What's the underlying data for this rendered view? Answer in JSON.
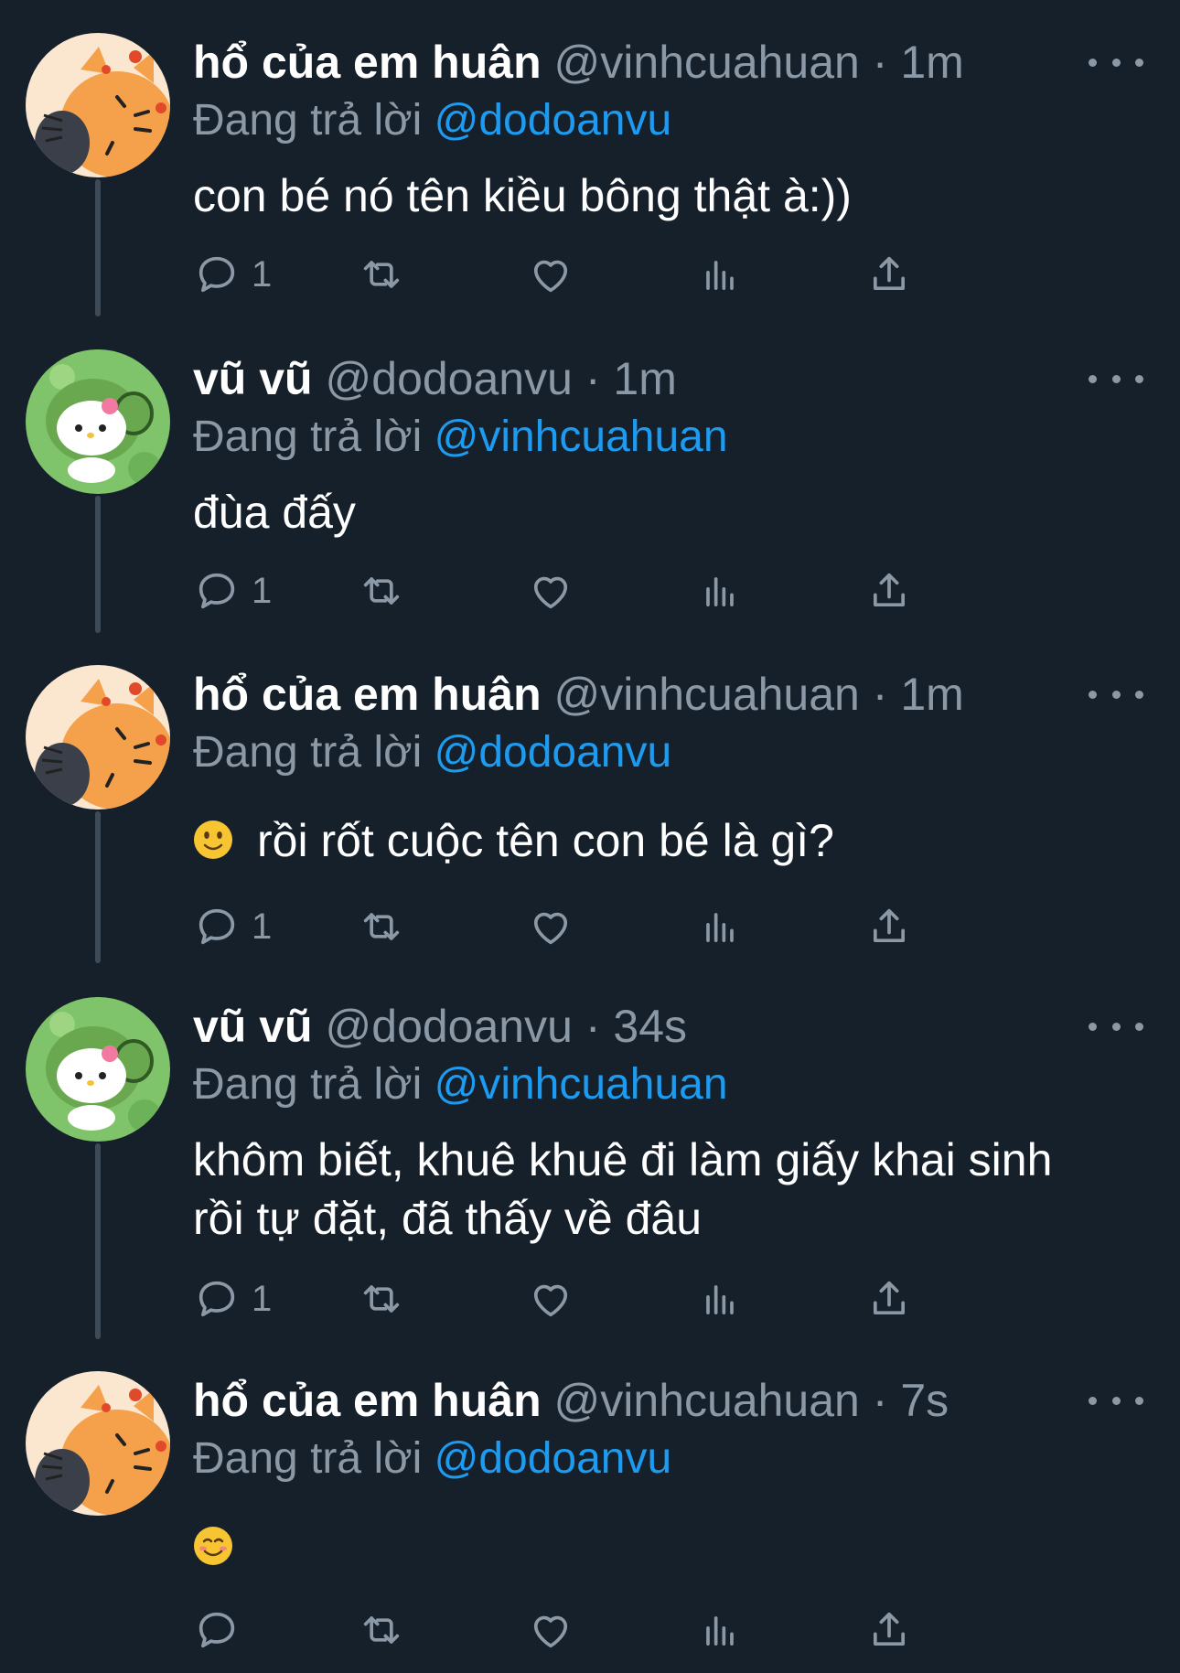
{
  "tweets": [
    {
      "name": "hổ của em huân",
      "handle": "@vinhcuahuan",
      "time": "1m",
      "replying_label": "Đang trả lời",
      "replying_to": "@dodoanvu",
      "text_lines": [
        "con bé nó tên kiều bông thật à:))"
      ],
      "emoji": "",
      "reply_count": "1",
      "avatar": "tiger-avatar"
    },
    {
      "name": "vũ vũ",
      "handle": "@dodoanvu",
      "time": "1m",
      "replying_label": "Đang trả lời",
      "replying_to": "@vinhcuahuan",
      "text_lines": [
        "đùa đấy"
      ],
      "emoji": "",
      "reply_count": "1",
      "avatar": "hello-kitty-avatar"
    },
    {
      "name": "hổ của em huân",
      "handle": "@vinhcuahuan",
      "time": "1m",
      "replying_label": "Đang trả lời",
      "replying_to": "@dodoanvu",
      "text_lines": [
        "rồi rốt cuộc tên con bé là gì?"
      ],
      "emoji": "slightly-smiling-face-emoji",
      "reply_count": "1",
      "avatar": "tiger-avatar"
    },
    {
      "name": "vũ vũ",
      "handle": "@dodoanvu",
      "time": "34s",
      "replying_label": "Đang trả lời",
      "replying_to": "@vinhcuahuan",
      "text_lines": [
        "khôm biết, khuê khuê đi làm giấy khai sinh",
        "rồi tự đặt, đã thấy về đâu"
      ],
      "emoji": "",
      "reply_count": "1",
      "avatar": "hello-kitty-avatar"
    },
    {
      "name": "hổ của em huân",
      "handle": "@vinhcuahuan",
      "time": "7s",
      "replying_label": "Đang trả lời",
      "replying_to": "@dodoanvu",
      "text_lines": [],
      "emoji": "smiling-face-emoji",
      "reply_count": "",
      "avatar": "tiger-avatar"
    }
  ],
  "separator_dot": "·",
  "colors": {
    "background": "#15202b",
    "text": "#ffffff",
    "secondary": "#8b98a5",
    "mention": "#1d9bf0",
    "thread_line": "#3d4a57"
  },
  "action_icons": [
    "reply-icon",
    "retweet-icon",
    "like-icon",
    "views-icon",
    "share-icon"
  ]
}
